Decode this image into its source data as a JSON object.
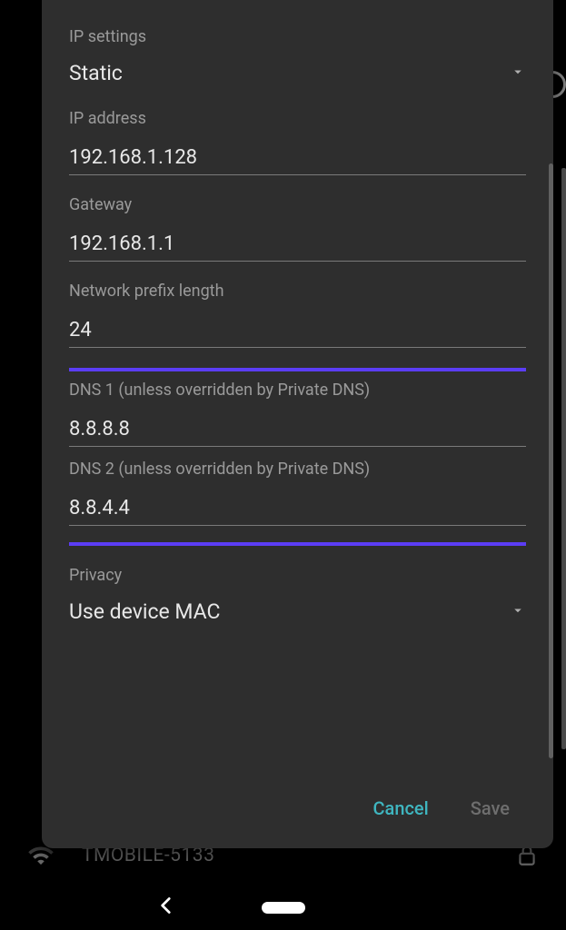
{
  "fields": {
    "ip_settings": {
      "label": "IP settings",
      "value": "Static"
    },
    "ip_address": {
      "label": "IP address",
      "value": "192.168.1.128"
    },
    "gateway": {
      "label": "Gateway",
      "value": "192.168.1.1"
    },
    "prefix": {
      "label": "Network prefix length",
      "value": "24"
    },
    "dns1": {
      "label": "DNS 1 (unless overridden by Private DNS)",
      "value": "8.8.8.8"
    },
    "dns2": {
      "label": "DNS 2 (unless overridden by Private DNS)",
      "value": "8.8.4.4"
    },
    "privacy": {
      "label": "Privacy",
      "value": "Use device MAC"
    }
  },
  "actions": {
    "cancel": "Cancel",
    "save": "Save"
  },
  "background": {
    "wifi_name": "TMOBILE-5133"
  }
}
